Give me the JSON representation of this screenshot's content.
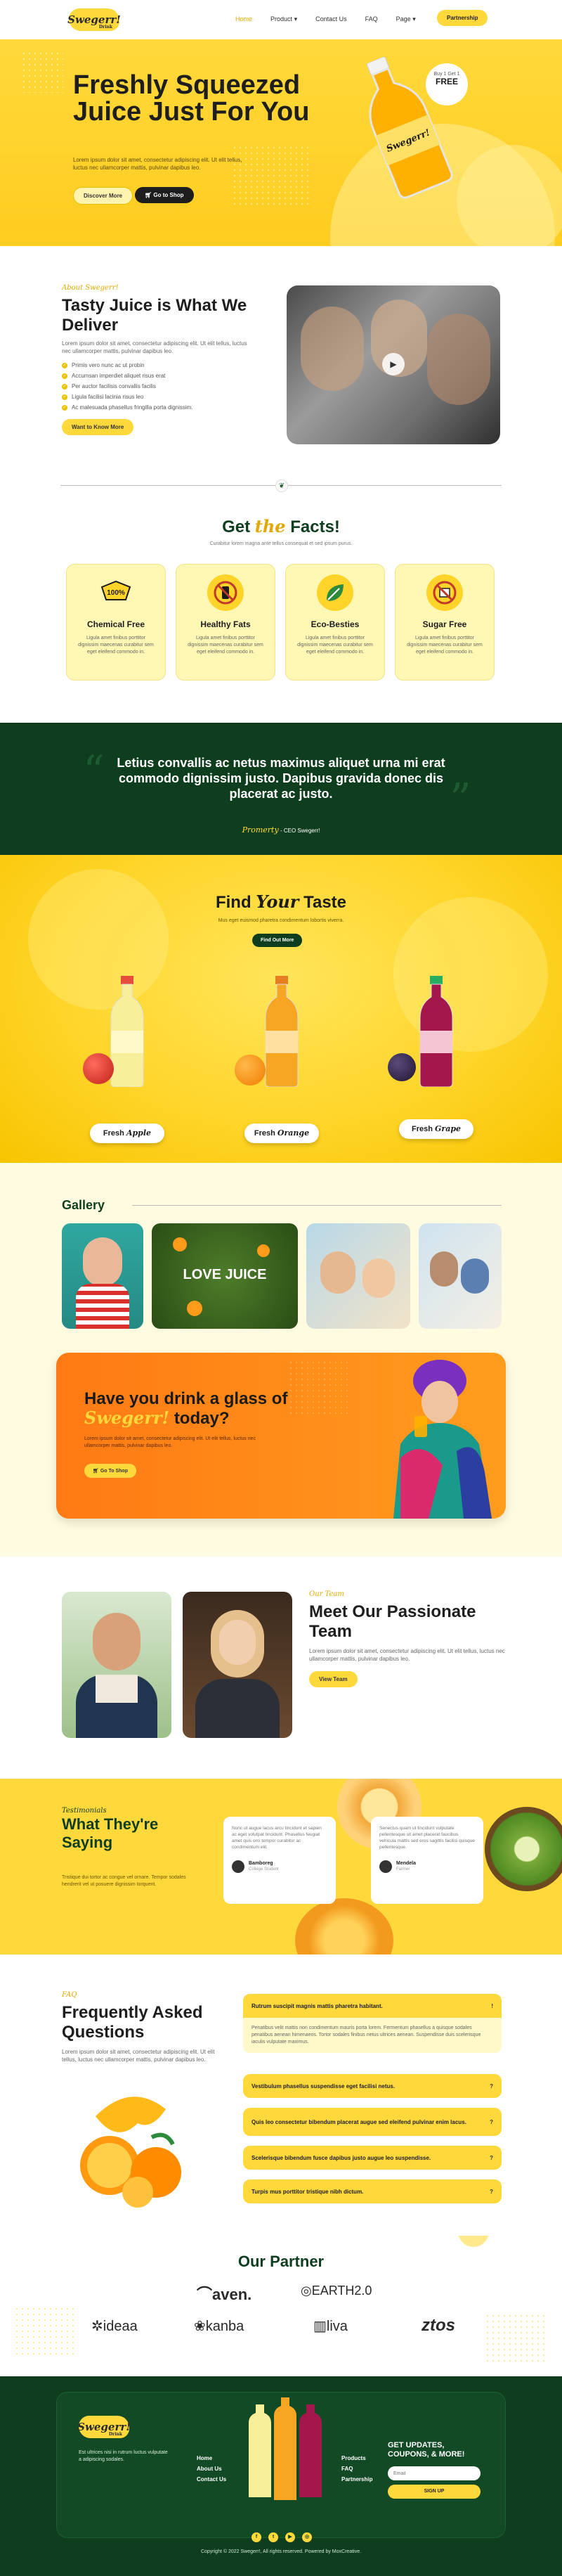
{
  "header": {
    "logo": "Swegerr!",
    "logo_sub": "Drink",
    "nav": [
      "Home",
      "Product",
      "Contact Us",
      "FAQ",
      "Page"
    ],
    "nav_dropdown_marker": "▾",
    "cta": "Partnership"
  },
  "hero": {
    "title": "Freshly Squeezed Juice Just For You",
    "paragraph": "Lorem ipsum dolor sit amet, consectetur adipiscing elit. Ut elit tellus, luctus nec ullamcorper mattis, pulvinar dapibus leo.",
    "discover": "Discover More",
    "shop": "Go to Shop",
    "badge_top": "Buy 1 Get 1",
    "badge_free": "FREE",
    "bottle_label": "Swegerr!"
  },
  "about": {
    "eyebrow": "About Swegerr!",
    "title": "Tasty Juice is What We Deliver",
    "paragraph": "Lorem ipsum dolor sit amet, consectetur adipiscing elit. Ut elit tellus, luctus nec ullamcorper mattis, pulvinar dapibus leo.",
    "checklist": [
      "Primis vero nunc ac ut probin",
      "Accumsan imperdiet aliquet risus erat",
      "Per auctor facilisis convallis facilis",
      "Ligula facilisi lacinia risus leo",
      "Ac malesuada phasellus fringilla porta dignissim."
    ],
    "cta": "Want to Know More"
  },
  "facts": {
    "title_get": "Get",
    "title_the": "the",
    "title_facts": "Facts!",
    "subtitle": "Curabitur lorem magna ante tellus consequat et sed ipsum purus.",
    "cards": [
      {
        "title": "Chemical Free",
        "text": "Ligula amet finibus porttitor dignissim maecenas curabitur sem eget eleifend commodo in.",
        "badge": "100%"
      },
      {
        "title": "Healthy Fats",
        "text": "Ligula amet finibus porttitor dignissim maecenas curabitur sem eget eleifend commodo in."
      },
      {
        "title": "Eco-Besties",
        "text": "Ligula amet finibus porttitor dignissim maecenas curabitur sem eget eleifend commodo in."
      },
      {
        "title": "Sugar Free",
        "text": "Ligula amet finibus porttitor dignissim maecenas curabitur sem eget eleifend commodo in."
      }
    ]
  },
  "quote": {
    "text": "Letius convallis ac netus maximus aliquet urna mi erat commodo dignissim justo. Dapibus gravida donec dis placerat ac justo.",
    "signature": "Promerty",
    "author": "- CEO Swegerr!"
  },
  "taste": {
    "title_find": "Find",
    "title_your": "Your",
    "title_taste": "Taste",
    "subtitle": "Mus eget euismod pharetra condimentum lobortis viverra.",
    "cta": "Find Out More",
    "items": [
      {
        "prefix": "Fresh",
        "flavor": "Apple"
      },
      {
        "prefix": "Fresh",
        "flavor": "Orange"
      },
      {
        "prefix": "Fresh",
        "flavor": "Grape"
      }
    ]
  },
  "gallery": {
    "title": "Gallery",
    "love_juice": "LOVE JUICE"
  },
  "promo": {
    "title_a": "Have you drink a glass of",
    "brand": "Swegerr!",
    "title_b": "today?",
    "paragraph": "Lorem ipsum dolor sit amet, consectetur adipiscing elit. Ut elit tellus, luctus nec ullamcorper mattis, pulvinar dapibus leo.",
    "cta": "Go To Shop"
  },
  "team": {
    "eyebrow": "Our Team",
    "title": "Meet Our Passionate Team",
    "paragraph": "Lorem ipsum dolor sit amet, consectetur adipiscing elit. Ut elit tellus, luctus nec ullamcorper mattis, pulvinar dapibus leo.",
    "cta": "View Team"
  },
  "testimonials": {
    "eyebrow": "Testimonials",
    "title": "What They're Saying",
    "paragraph": "Tristique dui tortor ac congue vel ornare. Tempor sodales hendrerit vel ut posuere dignissim torquent.",
    "cards": [
      {
        "text": "Nunc ut augue lacus arcu tincidunt et sapien ac eget volutpat tincidunt. Phasellus feugiat amet quis orci tempor curabitur ac condimentum elit.",
        "name": "Bamboreg",
        "role": "College Student"
      },
      {
        "text": "Senectus quam ut tincidunt vulputate pellentesque sit amet placerat faucibus vehicula mattis sed eros sagittis facilisi quisque pellentesque.",
        "name": "Mendela",
        "role": "Farmer"
      }
    ]
  },
  "faq": {
    "eyebrow": "FAQ",
    "title": "Frequently Asked Questions",
    "paragraph": "Lorem ipsum dolor sit amet, consectetur adipiscing elit. Ut elit tellus, luctus nec ullamcorper mattis, pulvinar dapibus leo.",
    "items": [
      {
        "q": "Rutrum suscipit magnis mattis pharetra habitant.",
        "open": true,
        "a": "Penatibus velit mattis non condimentum mauris porta lorem. Fermentum phasellus a quisque sodales penatibus aenean himenaeos. Tortor sodales finibus netus ultrices aenean. Suspendisse duis scelerisque iaculis vulputate maximus."
      },
      {
        "q": "Vestibulum phasellus suspendisse eget facilisi netus.",
        "open": false
      },
      {
        "q": "Quis leo consectetur bibendum placerat augue sed eleifend pulvinar enim lacus.",
        "open": false
      },
      {
        "q": "Scelerisque bibendum fusce dapibus justo augue leo suspendisse.",
        "open": false
      },
      {
        "q": "Turpis mus porttitor tristique nibh dictum.",
        "open": false
      }
    ],
    "open_marker": "!",
    "closed_marker": "?"
  },
  "partner": {
    "title": "Our Partner",
    "logos": [
      "aven.",
      "EARTH2.0",
      "ideaa",
      "kanba",
      "liva",
      "ztos"
    ]
  },
  "footer": {
    "logo": "Swegerr!",
    "logo_sub": "Drink",
    "about": "Est ultrices nisi in rutrum luctus vulputate a adipiscing sodales.",
    "col1": [
      "Home",
      "About Us",
      "Contact Us"
    ],
    "col2": [
      "Products",
      "FAQ",
      "Partnership"
    ],
    "newsletter_title": "GET UPDATES, COUPONS, & MORE!",
    "email_placeholder": "Email",
    "signup": "SIGN UP",
    "social": [
      "f",
      "t",
      "▶",
      "◎"
    ],
    "copyright": "Copyright © 2022 Swegerr!, All rights reserved. Powered by MoxCreative."
  },
  "colors": {
    "yellow": "#ffd93b",
    "dark_green": "#0f3e1f",
    "orange": "#ff8a18"
  }
}
